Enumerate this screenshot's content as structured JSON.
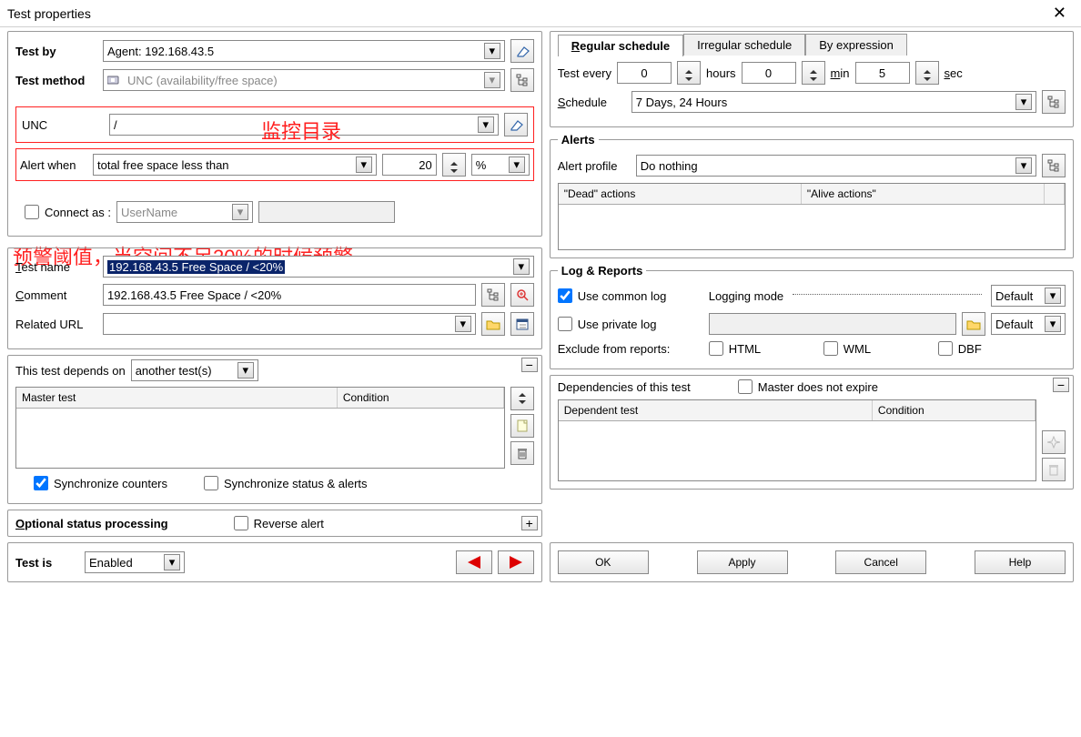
{
  "window_title": "Test properties",
  "labels": {
    "test_by": "Test by",
    "test_method": "Test method",
    "unc": "UNC",
    "alert_when": "Alert when",
    "connect_as": "Connect as :",
    "test_name": "Test name",
    "comment": "Comment",
    "related_url": "Related URL",
    "this_test_depends_on": "This test depends on",
    "master_test": "Master test",
    "condition": "Condition",
    "sync_counters": "Synchronize counters",
    "sync_status": "Synchronize status & alerts",
    "optional_status": "Optional status processing",
    "reverse_alert": "Reverse alert",
    "test_is": "Test is",
    "regular_schedule": "Regular schedule",
    "irregular_schedule": "Irregular schedule",
    "by_expression": "By expression",
    "test_every": "Test every",
    "hours": "hours",
    "min": "min",
    "sec": "sec",
    "schedule": "Schedule",
    "alerts": "Alerts",
    "alert_profile": "Alert profile",
    "dead_actions": "\"Dead\" actions",
    "alive_actions": "\"Alive actions\"",
    "log_reports": "Log & Reports",
    "use_common_log": "Use common log",
    "use_private_log": "Use private log",
    "logging_mode": "Logging mode",
    "exclude_from_reports": "Exclude from reports:",
    "html": "HTML",
    "wml": "WML",
    "dbf": "DBF",
    "dependencies": "Dependencies of this test",
    "master_not_expire": "Master does not expire",
    "dependent_test": "Dependent test",
    "default": "Default"
  },
  "values": {
    "agent": "Agent: 192.168.43.5",
    "method": "UNC (availability/free space)",
    "unc_path": "/",
    "alert_condition": "total free space less than",
    "alert_value": "20",
    "alert_unit": "%",
    "username_placeholder": "UserName",
    "test_name_val": "192.168.43.5 Free Space / <20%",
    "comment_val": "192.168.43.5 Free Space / <20%",
    "depends_on": "another test(s)",
    "test_is_val": "Enabled",
    "hours_val": "0",
    "min_val": "0",
    "sec_val": "5",
    "schedule_val": "7 Days, 24 Hours",
    "alert_profile_val": "Do nothing"
  },
  "annotations": {
    "monitor_dir": "监控目录",
    "threshold": "预警阈值，当空间不足20%的时候预警"
  },
  "buttons": {
    "ok": "OK",
    "apply": "Apply",
    "cancel": "Cancel",
    "help": "Help"
  }
}
